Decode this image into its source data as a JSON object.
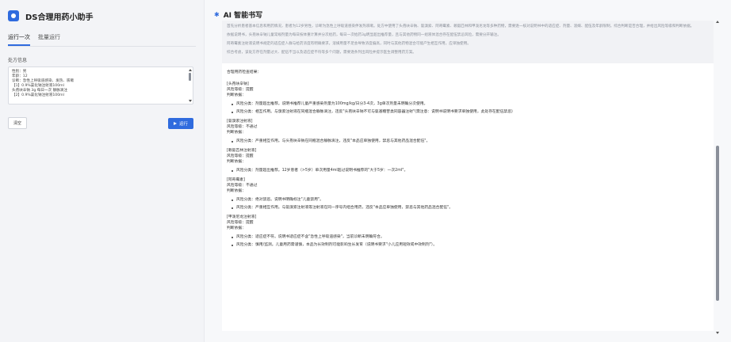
{
  "app": {
    "title": "DS合理用药小助手"
  },
  "tabs": [
    {
      "label": "运行一次"
    },
    {
      "label": "批量运行"
    }
  ],
  "input": {
    "label": "处方信息",
    "lines": [
      "性别：男",
      "年龄：12",
      "诊断：急性上呼吸道感染、发热、咳嗽",
      "【1】0.9%氯化钠注射液100ml",
      "    头孢呋辛钠 3g 每日一次 静脉滴注",
      "【2】0.9%氯化钠注射液100ml"
    ]
  },
  "buttons": {
    "clear": "清空",
    "run": "运行"
  },
  "panel": {
    "title": "AI 智能书写"
  },
  "thinking": [
    "首先分析患者基本信息和用药情况，患者为12岁男性，诊断为急性上呼吸道感染伴发热咳嗽。处方中使用了头孢呋辛钠、氨溴索、阿奇霉素、赖氨匹林和甲泼尼龙等多种药物，需要逐一核对说明书中的适应症、剂量、溶媒、配伍及年龄限制，综合判断是否合理，并给出风险等级和判断依据。",
    "依据说明书，头孢呋辛钠儿童常规剂量为每日按体重计算并分次给药，每日一次给药3g明显超出推荐量，且与其他药物同一组液体混合存在配伍禁忌风险，需要分开输注。",
    "阿奇霉素注射液说明书规定的适应症人群与给药浓度有明确要求，溶媒用量不足会导致浓度偏高，同时与其他药物混合可能产生相互作用，应单独使用。",
    "综合考虑，该处方存在剂量过大、配伍不当以及适应症不符等多个问题，需要逐条列出风险并提示医生调整用药方案。"
  ],
  "result": {
    "intro": "合理用药检查结果：",
    "drugs": [
      {
        "name": "[头孢呋辛钠]",
        "risk": "风险等级：提醒",
        "basis": "判断依据：",
        "points": [
          "风险分类：剂量超出推荐。说明书推荐儿童严重感染剂量为100mg/kg/日分3-4次，3g单次剂量未明确分次使用。",
          "风险分类：相互作用。与溴索注射液在同瓶混合静脉滴注，违反\"头孢呋辛钠不可与氨基糖苷类同容器注射\"(需注意：说明书说明书要求单独使用，此处存在配伍禁忌)"
        ]
      },
      {
        "name": "[氨溴索注射液]",
        "risk": "风险等级：不通过",
        "basis": "判断依据：",
        "points": [
          "风险分类：严重相互作用。与头孢呋辛钠在同瓶混合静脉滴注，违反\"本品应单独使用，禁忌与其他药品混合配伍\"。"
        ]
      },
      {
        "name": "[赖氨匹林注射液]",
        "risk": "风险等级：提醒",
        "basis": "判断依据：",
        "points": [
          "风险分类：剂量超出推荐。12岁患者（>5岁）单次用量4ml超过说明书推荐的\"大于5岁：一次2ml\"。"
        ]
      },
      {
        "name": "[阿奇霉素]",
        "risk": "风险等级：不通过",
        "basis": "判断依据：",
        "points": [
          "风险分类：绝对禁忌。说明书明确标注\"儿童禁用\"。",
          "风险分类：严重相互作用。与氨溴索注射液等注射液在同一序号内组合用药，违反\"本品应单独使用，禁忌与其他药品混合配伍\"。"
        ]
      },
      {
        "name": "[甲泼尼龙注射液]",
        "risk": "风险等级：提醒",
        "basis": "判断依据：",
        "points": [
          "风险分类：适应症不符。说明书适应症不含\"急性上呼吸道感染\"，当前诊断未明确符合。",
          "风险分类：慎用/监测。儿童用药需谨慎，本品为长效制剂可能影响生长发育（说明书要求\"小儿应用短效或中效制剂\"）。"
        ]
      }
    ]
  }
}
